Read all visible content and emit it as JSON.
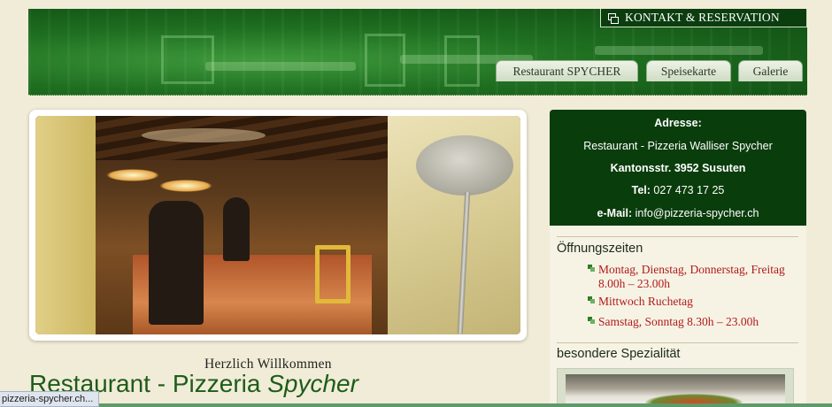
{
  "header": {
    "contact_tab": "KONTAKT & RESERVATION",
    "nav": [
      "Restaurant SPYCHER",
      "Speisekarte",
      "Galerie"
    ]
  },
  "main": {
    "welcome": "Herzlich Willkommen",
    "title_plain": "Restaurant - Pizzeria ",
    "title_italic": "Spycher"
  },
  "address": {
    "heading": "Adresse:",
    "name": "Restaurant - Pizzeria Walliser Spycher",
    "street": "Kantonsstr. 3952 Susuten",
    "tel_label": "Tel:",
    "tel": " 027 473 17 25",
    "email_label": "e-Mail:",
    "email": " info@pizzeria-spycher.ch"
  },
  "hours": {
    "heading": "Öffnungszeiten",
    "items": [
      "Montag, Dienstag, Donnerstag, Freitag 8.00h – 23.00h",
      "Mittwoch Ruchetag",
      "Samstag, Sonntag 8.30h – 23.00h"
    ]
  },
  "specialty": {
    "heading": "besondere Spezialität"
  },
  "statusbar": {
    "url": "pizzeria-spycher.ch..."
  }
}
